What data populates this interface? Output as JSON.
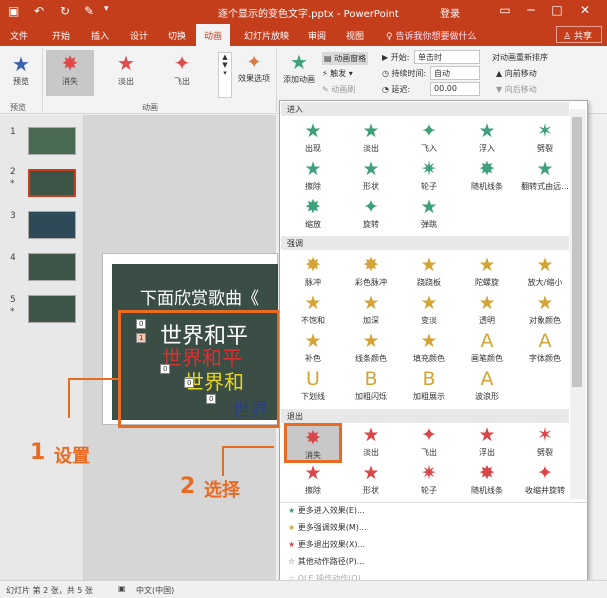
{
  "titlebar": {
    "title": "逐个显示的变色文字.pptx - PowerPoint",
    "login": "登录"
  },
  "tabs": [
    "文件",
    "开始",
    "插入",
    "设计",
    "切换",
    "动画",
    "幻灯片放映",
    "审阅",
    "视图"
  ],
  "tell_me": "♀ 告诉我你想要做什么",
  "share": "共享",
  "ribbon": {
    "preview": "预览",
    "preview_group": "预览",
    "gallery": [
      {
        "label": "消失",
        "icon": "✸",
        "color": "#e04a4a"
      },
      {
        "label": "淡出",
        "icon": "★",
        "color": "#e04a4a"
      },
      {
        "label": "飞出",
        "icon": "✦",
        "color": "#e04a4a"
      }
    ],
    "anim_group": "动画",
    "effect_options": "效果选项",
    "add_anim": "添加动画",
    "anim_pane": "动画窗格",
    "trigger": "触发",
    "anim_painter": "动画刷",
    "start_label": "开始:",
    "start_value": "单击时",
    "duration_label": "持续时间:",
    "duration_value": "自动",
    "delay_label": "延迟:",
    "delay_value": "00.00",
    "reorder": "对动画重新排序",
    "move_earlier": "▲ 向前移动",
    "move_later": "▼ 向后移动"
  },
  "slides": [
    "1",
    "2",
    "3",
    "4",
    "5"
  ],
  "slide": {
    "title": "下面欣赏歌曲《",
    "l1": "世界和平",
    "l2": "世界和平",
    "l3": "世界和",
    "l4": "世界",
    "n0": "0",
    "n1": "1",
    "n2": "0",
    "n3": "0",
    "n4": "0"
  },
  "annotations": {
    "n1": "1",
    "t1": "设置",
    "n2": "2",
    "t2": "选择"
  },
  "status": {
    "slide": "幻灯片 第 2 张，共 5 张",
    "lang": "中文(中国)"
  },
  "dropdown": {
    "entrance_head": "进入",
    "entrance": [
      {
        "l": "出现",
        "i": "★"
      },
      {
        "l": "淡出",
        "i": "★"
      },
      {
        "l": "飞入",
        "i": "✦"
      },
      {
        "l": "浮入",
        "i": "★"
      },
      {
        "l": "劈裂",
        "i": "✶"
      },
      {
        "l": "擦除",
        "i": "★"
      },
      {
        "l": "形状",
        "i": "★"
      },
      {
        "l": "轮子",
        "i": "✷"
      },
      {
        "l": "随机线条",
        "i": "✸"
      },
      {
        "l": "翻转式由远...",
        "i": "★"
      },
      {
        "l": "缩放",
        "i": "✸"
      },
      {
        "l": "旋转",
        "i": "✦"
      },
      {
        "l": "弹跳",
        "i": "★"
      }
    ],
    "emph_head": "强调",
    "emph": [
      {
        "l": "脉冲",
        "i": "✸"
      },
      {
        "l": "彩色脉冲",
        "i": "✸"
      },
      {
        "l": "跷跷板",
        "i": "★"
      },
      {
        "l": "陀螺旋",
        "i": "★"
      },
      {
        "l": "放大/缩小",
        "i": "★"
      },
      {
        "l": "不饱和",
        "i": "★"
      },
      {
        "l": "加深",
        "i": "★"
      },
      {
        "l": "变淡",
        "i": "★"
      },
      {
        "l": "透明",
        "i": "★"
      },
      {
        "l": "对象颜色",
        "i": "★"
      },
      {
        "l": "补色",
        "i": "★"
      },
      {
        "l": "线条颜色",
        "i": "★"
      },
      {
        "l": "填充颜色",
        "i": "★"
      },
      {
        "l": "画笔颜色",
        "i": "A"
      },
      {
        "l": "字体颜色",
        "i": "A"
      },
      {
        "l": "下划线",
        "i": "U"
      },
      {
        "l": "加粗闪烁",
        "i": "B"
      },
      {
        "l": "加粗展示",
        "i": "B"
      },
      {
        "l": "波浪形",
        "i": "A"
      }
    ],
    "exit_head": "退出",
    "exit": [
      {
        "l": "消失",
        "i": "✸"
      },
      {
        "l": "淡出",
        "i": "★"
      },
      {
        "l": "飞出",
        "i": "✦"
      },
      {
        "l": "浮出",
        "i": "★"
      },
      {
        "l": "劈裂",
        "i": "✶"
      },
      {
        "l": "擦除",
        "i": "★"
      },
      {
        "l": "形状",
        "i": "★"
      },
      {
        "l": "轮子",
        "i": "✷"
      },
      {
        "l": "随机线条",
        "i": "✸"
      },
      {
        "l": "收缩并旋转",
        "i": "✦"
      }
    ],
    "menu": [
      "更多进入效果(E)...",
      "更多强调效果(M)...",
      "更多退出效果(X)...",
      "其他动作路径(P)...",
      "OLE 操作动作(O)..."
    ],
    "colors": {
      "entrance": "#3fa07a",
      "emph": "#d4a437",
      "exit": "#d8474a"
    }
  }
}
